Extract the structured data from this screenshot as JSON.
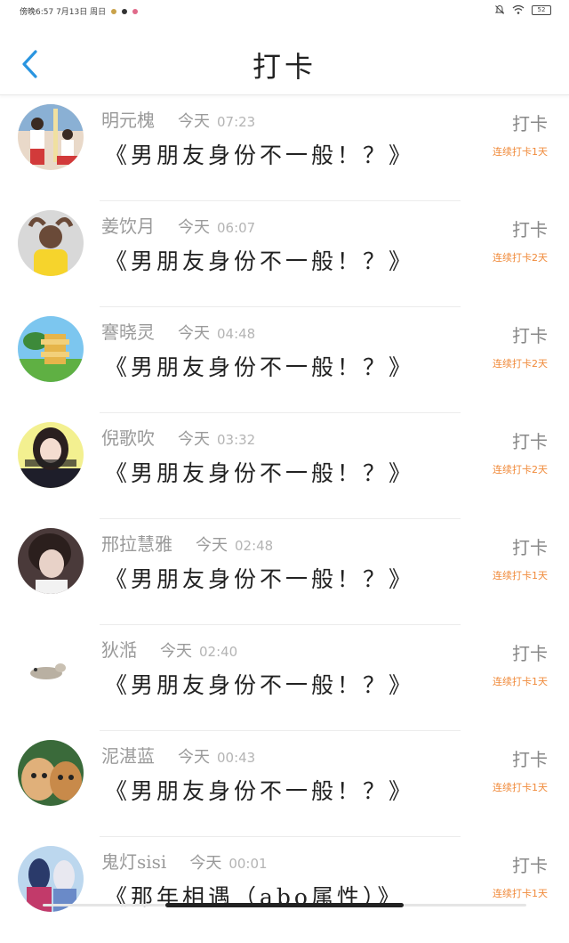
{
  "status": {
    "left": "傍晚6:57  7月13日  周日",
    "battery": "52"
  },
  "header": {
    "title": "打卡",
    "back_icon": "chevron-left-icon",
    "accent": "#2a95e0"
  },
  "colors": {
    "streak": "#f08a3a",
    "muted": "#9a9a9a"
  },
  "rows": [
    {
      "name": "明元槐",
      "day": "今天",
      "time": "07:23",
      "book": "《男朋友身份不一般！？》",
      "action": "打卡",
      "streak": "连续打卡1天",
      "avatar": "photo-two-girls"
    },
    {
      "name": "姜饮月",
      "day": "今天",
      "time": "06:07",
      "book": "《男朋友身份不一般！？》",
      "action": "打卡",
      "streak": "连续打卡2天",
      "avatar": "photo-child-yellow"
    },
    {
      "name": "謇晓灵",
      "day": "今天",
      "time": "04:48",
      "book": "《男朋友身份不一般！？》",
      "action": "打卡",
      "streak": "连续打卡2天",
      "avatar": "cartoon-sign"
    },
    {
      "name": "倪歌吹",
      "day": "今天",
      "time": "03:32",
      "book": "《男朋友身份不一般！？》",
      "action": "打卡",
      "streak": "连续打卡2天",
      "avatar": "photo-girl-yellow"
    },
    {
      "name": "邢拉慧雅",
      "day": "今天",
      "time": "02:48",
      "book": "《男朋友身份不一般！？》",
      "action": "打卡",
      "streak": "连续打卡1天",
      "avatar": "photo-portrait"
    },
    {
      "name": "狄湉",
      "day": "今天",
      "time": "02:40",
      "book": "《男朋友身份不一般！？》",
      "action": "打卡",
      "streak": "连续打卡1天",
      "avatar": "cartoon-animal"
    },
    {
      "name": "泥湛蓝",
      "day": "今天",
      "time": "00:43",
      "book": "《男朋友身份不一般！？》",
      "action": "打卡",
      "streak": "连续打卡1天",
      "avatar": "photo-cats"
    },
    {
      "name": "鬼灯sisi",
      "day": "今天",
      "time": "00:01",
      "book": "《那年相遇（abo属性）》",
      "action": "打卡",
      "streak": "连续打卡1天",
      "avatar": "anime-girls"
    }
  ]
}
